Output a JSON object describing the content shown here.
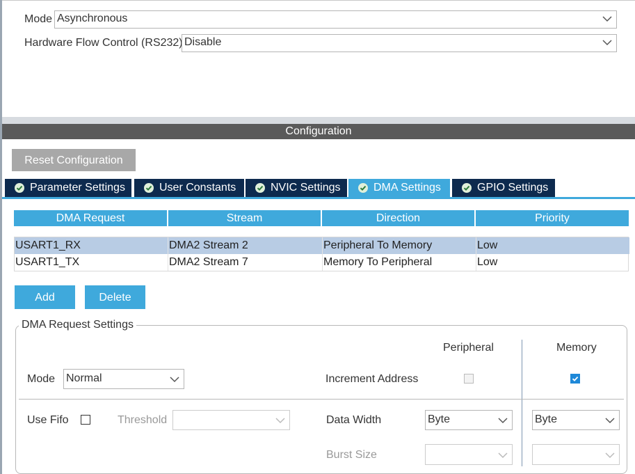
{
  "mode_section": {
    "mode_label": "Mode",
    "mode_value": "Asynchronous",
    "flow_label": "Hardware Flow Control (RS232)",
    "flow_value": "Disable"
  },
  "config": {
    "header": "Configuration",
    "reset_button": "Reset Configuration"
  },
  "tabs": [
    {
      "label": "Parameter Settings",
      "active": false
    },
    {
      "label": "User Constants",
      "active": false
    },
    {
      "label": "NVIC Settings",
      "active": false
    },
    {
      "label": "DMA Settings",
      "active": true
    },
    {
      "label": "GPIO Settings",
      "active": false
    }
  ],
  "dma_table": {
    "columns": [
      "DMA Request",
      "Stream",
      "Direction",
      "Priority"
    ],
    "rows": [
      {
        "request": "USART1_RX",
        "stream": "DMA2 Stream 2",
        "direction": "Peripheral To Memory",
        "priority": "Low",
        "selected": true
      },
      {
        "request": "USART1_TX",
        "stream": "DMA2 Stream 7",
        "direction": "Memory To Peripheral",
        "priority": "Low",
        "selected": false
      }
    ]
  },
  "actions": {
    "add": "Add",
    "delete": "Delete"
  },
  "dma_request_settings": {
    "legend": "DMA Request Settings",
    "peripheral_header": "Peripheral",
    "memory_header": "Memory",
    "mode_label": "Mode",
    "mode_value": "Normal",
    "increment_label": "Increment Address",
    "increment_peripheral": false,
    "increment_memory": true,
    "use_fifo_label": "Use Fifo",
    "use_fifo": false,
    "threshold_label": "Threshold",
    "threshold_value": "",
    "data_width_label": "Data Width",
    "data_width_peripheral": "Byte",
    "data_width_memory": "Byte",
    "burst_size_label": "Burst Size",
    "burst_peripheral": "",
    "burst_memory": ""
  },
  "colors": {
    "accent": "#3fa9dc",
    "tab_dark": "#0d2a4e",
    "header_gray": "#5a5a5a",
    "selected_row": "#b8cce4"
  }
}
